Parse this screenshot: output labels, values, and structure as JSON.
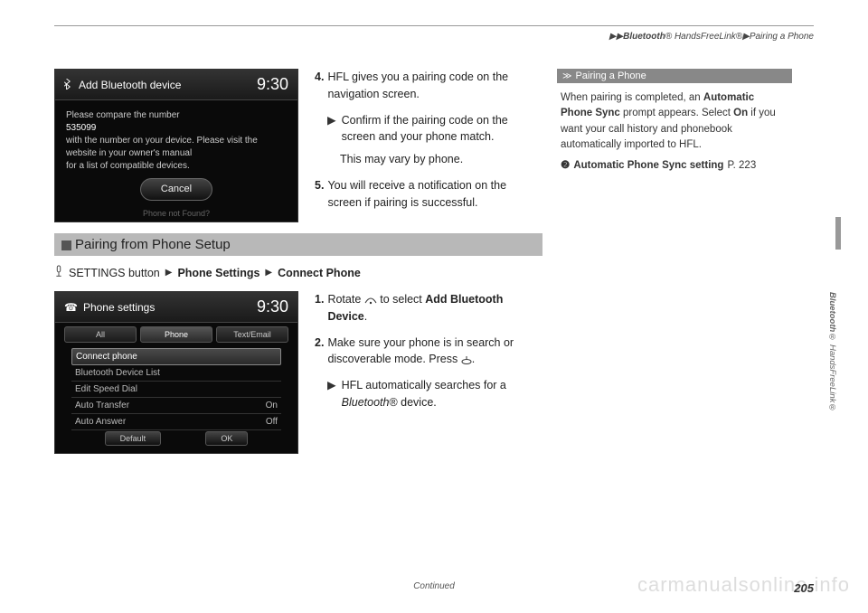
{
  "breadcrumb": {
    "sep": "▶▶",
    "part1_em": "Bluetooth",
    "part1_reg": "® HandsFreeLink®",
    "sep2": "▶",
    "part2": "Pairing a Phone"
  },
  "screenshot1": {
    "title": "Add Bluetooth device",
    "clock": "9:30",
    "line1": "Please compare the number",
    "code": "535099",
    "line2": "with the number on your device. Please visit the",
    "line3": "website in your owner's manual",
    "line4": "for a list of compatible devices.",
    "cancel": "Cancel",
    "footer": "Phone not Found?"
  },
  "steps_mid": {
    "s4": {
      "num": "4.",
      "text": "HFL gives you a pairing code on the navigation screen."
    },
    "s4sub": {
      "text": "Confirm if the pairing code on the screen and your phone match."
    },
    "s4note": "This may vary by phone.",
    "s5": {
      "num": "5.",
      "text": "You will receive a notification on the screen if pairing is successful."
    }
  },
  "section_header": "Pairing from Phone Setup",
  "path": {
    "p1": "SETTINGS button",
    "p2": "Phone Settings",
    "p3": "Connect Phone"
  },
  "screenshot2": {
    "title": "Phone settings",
    "clock": "9:30",
    "tabs": [
      "All",
      "Phone",
      "Text/Email"
    ],
    "rows": [
      {
        "label": "Connect phone",
        "value": ""
      },
      {
        "label": "Bluetooth Device List",
        "value": ""
      },
      {
        "label": "Edit Speed Dial",
        "value": ""
      },
      {
        "label": "Auto Transfer",
        "value": "On"
      },
      {
        "label": "Auto Answer",
        "value": "Off"
      }
    ],
    "btn1": "Default",
    "btn2": "OK"
  },
  "steps_bottom": {
    "s1": {
      "num": "1.",
      "text_pre": "Rotate ",
      "text_post": " to select ",
      "bold1": "Add Bluetooth Device",
      "tail": "."
    },
    "s2": {
      "num": "2.",
      "text": "Make sure your phone is in search or discoverable mode. Press ",
      "tail": "."
    },
    "s2sub": {
      "text_pre": "HFL automatically searches for a ",
      "em": "Bluetooth",
      "text_post": "® device."
    }
  },
  "sidebar": {
    "title": "Pairing a Phone",
    "body1": "When pairing is completed, an ",
    "bold1": "Automatic Phone Sync",
    "body2": " prompt appears. Select ",
    "bold2": "On",
    "body3": " if you want your call history and phonebook automatically imported to HFL.",
    "xref_label": "Automatic Phone Sync setting",
    "xref_page": "P. 223"
  },
  "vertical": {
    "em": "Bluetooth",
    "rest": "® HandsFreeLink®"
  },
  "continued": "Continued",
  "page_num": "205",
  "watermark": "carmanualsonline.info"
}
